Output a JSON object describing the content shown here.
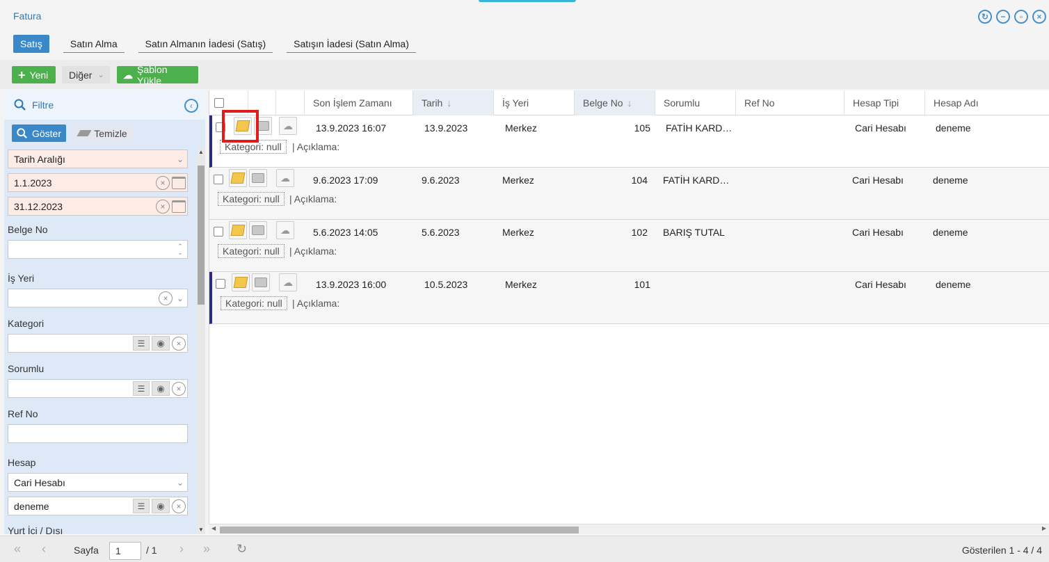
{
  "window": {
    "title": "Fatura"
  },
  "tabs": [
    {
      "label": "Satış"
    },
    {
      "label": "Satın Alma"
    },
    {
      "label": "Satın Almanın İadesi (Satış)"
    },
    {
      "label": "Satışın İadesi (Satın Alma)"
    }
  ],
  "toolbar": {
    "new_label": "Yeni",
    "other_label": "Diğer",
    "template_label": "Şablon Yükle"
  },
  "filter": {
    "title": "Filtre",
    "show_label": "Göster",
    "clear_label": "Temizle",
    "date_range_select": "Tarih Aralığı",
    "date_from": "1.1.2023",
    "date_to": "31.12.2023",
    "belge_no_label": "Belge No",
    "belge_no_value": "",
    "is_yeri_label": "İş Yeri",
    "kategori_label": "Kategori",
    "sorumlu_label": "Sorumlu",
    "ref_no_label": "Ref No",
    "hesap_label": "Hesap",
    "hesap_type": "Cari Hesabı",
    "hesap_value": "deneme",
    "yurt_label": "Yurt İçi / Dışı"
  },
  "grid": {
    "columns": [
      "Son İşlem Zamanı",
      "Tarih",
      "İş Yeri",
      "Belge No",
      "Sorumlu",
      "Ref No",
      "Hesap Tipi",
      "Hesap Adı"
    ],
    "category_text": "Kategori: null",
    "desc_text": "| Açıklama:",
    "rows": [
      {
        "son": "13.9.2023 16:07",
        "tarih": "13.9.2023",
        "isyeri": "Merkez",
        "belge": "105",
        "sorumlu": "FATİH KARD…",
        "ref": "",
        "tip": "Cari Hesabı",
        "ad": "deneme"
      },
      {
        "son": "9.6.2023 17:09",
        "tarih": "9.6.2023",
        "isyeri": "Merkez",
        "belge": "104",
        "sorumlu": "FATİH KARD…",
        "ref": "",
        "tip": "Cari Hesabı",
        "ad": "deneme"
      },
      {
        "son": "5.6.2023 14:05",
        "tarih": "5.6.2023",
        "isyeri": "Merkez",
        "belge": "102",
        "sorumlu": "BARIŞ TUTAL",
        "ref": "",
        "tip": "Cari Hesabı",
        "ad": "deneme"
      },
      {
        "son": "13.9.2023 16:00",
        "tarih": "10.5.2023",
        "isyeri": "Merkez",
        "belge": "101",
        "sorumlu": "",
        "ref": "",
        "tip": "Cari Hesabı",
        "ad": "deneme"
      }
    ]
  },
  "pager": {
    "page_label": "Sayfa",
    "page_value": "1",
    "page_total": "/ 1",
    "info": "Gösterilen 1 - 4 / 4"
  }
}
